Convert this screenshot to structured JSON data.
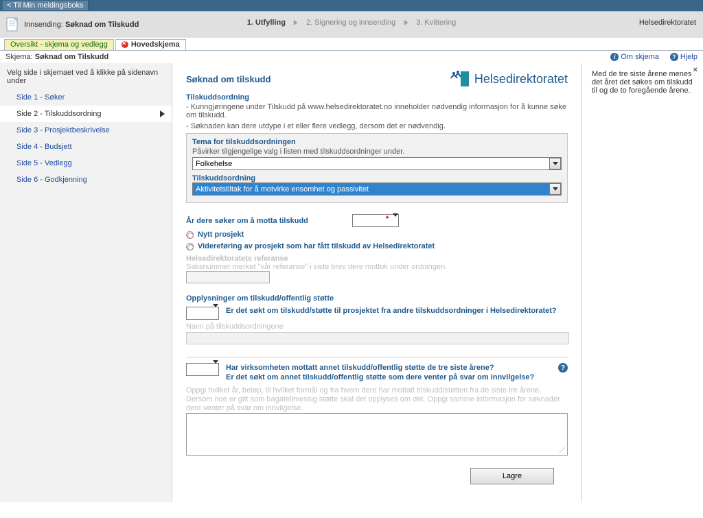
{
  "top": {
    "back_label": "< Til Min meldingsboks"
  },
  "header": {
    "prefix": "Innsending: ",
    "title": "Søknad om Tilskudd",
    "org": "Helsedirektoratet",
    "steps": [
      "1. Utfylling",
      "2. Signering og innsending",
      "3. Kvittering"
    ]
  },
  "tabs": {
    "overview": "Oversikt - skjema og vedlegg",
    "main": "Hovedskjema"
  },
  "schema_line": {
    "prefix": "Skjema: ",
    "name": "Søknad om Tilskudd",
    "om_skjema": "Om skjema",
    "hjelp": "Hjelp"
  },
  "sidebar": {
    "heading": "Velg side i skjemaet ved å klikke på sidenavn under",
    "items": [
      "Side 1 - Søker",
      "Side 2 - Tilskuddsordning",
      "Side 3 - Prosjektbeskrivelse",
      "Side 4 - Budsjett",
      "Side 5 - Vedlegg",
      "Side 6 - Godkjenning"
    ]
  },
  "form": {
    "title": "Søknad om tilskudd",
    "logo_text": "Helsedirektoratet",
    "ord": {
      "heading": "Tilskuddsordning",
      "line1": "- Kunngjøringene under Tilskudd på www.helsedirektoratet.no inneholder nødvendig informasjon for å kunne søke om tilskudd.",
      "line2": "- Søknaden kan dere utdype i et eller flere vedlegg, dersom det er nødvendig."
    },
    "tema": {
      "title": "Tema for tilskuddsordningen",
      "text": "Påvirker tilgjengelige valg i listen med tilskuddsordninger under.",
      "value": "Folkehelse"
    },
    "ordning": {
      "title": "Tilskuddsordning",
      "value": "Aktivitetstiltak for å motvirke ensomhet og passivitet"
    },
    "year": {
      "label": "År dere søker om å motta tilskudd"
    },
    "radio": {
      "nytt": "Nytt prosjekt",
      "videre": "Videreføring av prosjekt som har fått tilskudd av Helsedirektoratet"
    },
    "ref": {
      "title": "Helsedirektoratets referanse",
      "text": "Saksnummer merket \"vår referanse\" i siste brev dere mottok under ordningen."
    },
    "opp": {
      "heading": "Opplysninger om tilskudd/offentlig støtte",
      "q1": "Er det søkt om tilskudd/støtte til prosjektet fra andre tilskuddsordninger i Helsedirektoratet?",
      "navn": "Navn på tilskuddsordningene",
      "q2a": "Har virksomheten mottatt annet tilskudd/offentlig støtte de tre siste årene?",
      "q2b": "Er det søkt om annet tilskudd/offentlig støtte som dere venter på svar om innvilgelse?",
      "help": "Oppgi hvilket år, beløp, til hvilket formål og fra hvem dere har mottatt tilskudd/støtten fra de siste tre årene. Dersom noe er gitt som bagatellmessig støtte skal det opplyses om det. Oppgi samme informasjon for søknader dere venter på svar om innvilgelse."
    },
    "save": "Lagre"
  },
  "helpcol": {
    "text": "Med de tre siste årene menes det året det søkes om tilskudd til og de to foregående årene."
  }
}
